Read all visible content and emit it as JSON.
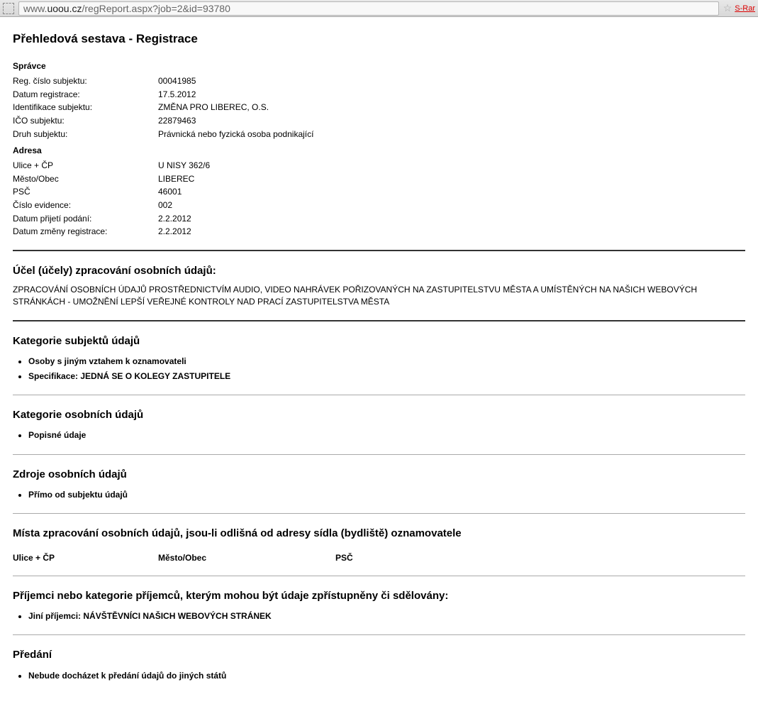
{
  "browser": {
    "url_prefix": "www.",
    "url_domain": "uoou.cz",
    "url_path": "/regReport.aspx?job=2&id=93780",
    "star": "☆",
    "srank": "S-Rar"
  },
  "title": "Přehledová sestava - Registrace",
  "spravce": {
    "heading": "Správce",
    "rows": [
      {
        "k": "Reg. číslo subjektu:",
        "v": "00041985"
      },
      {
        "k": "Datum registrace:",
        "v": "17.5.2012"
      },
      {
        "k": "Identifikace subjektu:",
        "v": "ZMĚNA PRO LIBEREC, O.S."
      },
      {
        "k": "IČO subjektu:",
        "v": "22879463"
      },
      {
        "k": "Druh subjektu:",
        "v": "Právnická nebo fyzická osoba podnikající"
      }
    ]
  },
  "adresa": {
    "heading": "Adresa",
    "rows": [
      {
        "k": "Ulice + ČP",
        "v": "U NISY 362/6"
      },
      {
        "k": "Město/Obec",
        "v": "LIBEREC"
      },
      {
        "k": "PSČ",
        "v": "46001"
      },
      {
        "k": "Číslo evidence:",
        "v": "002"
      },
      {
        "k": "Datum přijetí podání:",
        "v": "2.2.2012"
      },
      {
        "k": "Datum změny registrace:",
        "v": "2.2.2012"
      }
    ]
  },
  "ucel": {
    "heading": "Účel (účely) zpracování osobních údajů:",
    "text": "ZPRACOVÁNÍ OSOBNÍCH ÚDAJŮ PROSTŘEDNICTVÍM AUDIO, VIDEO NAHRÁVEK POŘIZOVANÝCH NA ZASTUPITELSTVU MĚSTA A UMÍSTĚNÝCH NA NAŠICH WEBOVÝCH STRÁNKÁCH - UMOŽNĚNÍ LEPŠÍ VEŘEJNÉ KONTROLY NAD PRACÍ ZASTUPITELSTVA MĚSTA"
  },
  "kat_subjektu": {
    "heading": "Kategorie subjektů údajů",
    "items": [
      "Osoby s jiným vztahem k oznamovateli",
      "Specifikace: JEDNÁ SE O KOLEGY ZASTUPITELE"
    ]
  },
  "kat_osobnich": {
    "heading": "Kategorie osobních údajů",
    "items": [
      "Popisné údaje"
    ]
  },
  "zdroje": {
    "heading": "Zdroje osobních údajů",
    "items": [
      "Přímo od subjektu údajů"
    ]
  },
  "mista": {
    "heading": "Místa zpracování osobních údajů, jsou-li odlišná od adresy sídla (bydliště) oznamovatele",
    "cols": {
      "c1": "Ulice + ČP",
      "c2": "Město/Obec",
      "c3": "PSČ"
    }
  },
  "prijemci": {
    "heading": "Příjemci nebo kategorie příjemců, kterým mohou být údaje zpřístupněny či sdělovány:",
    "items": [
      "Jiní příjemci: NÁVŠTĚVNÍCI NAŠICH WEBOVÝCH STRÁNEK"
    ]
  },
  "predani": {
    "heading": "Předání",
    "items": [
      "Nebude docházet k předání údajů do jiných států"
    ]
  }
}
